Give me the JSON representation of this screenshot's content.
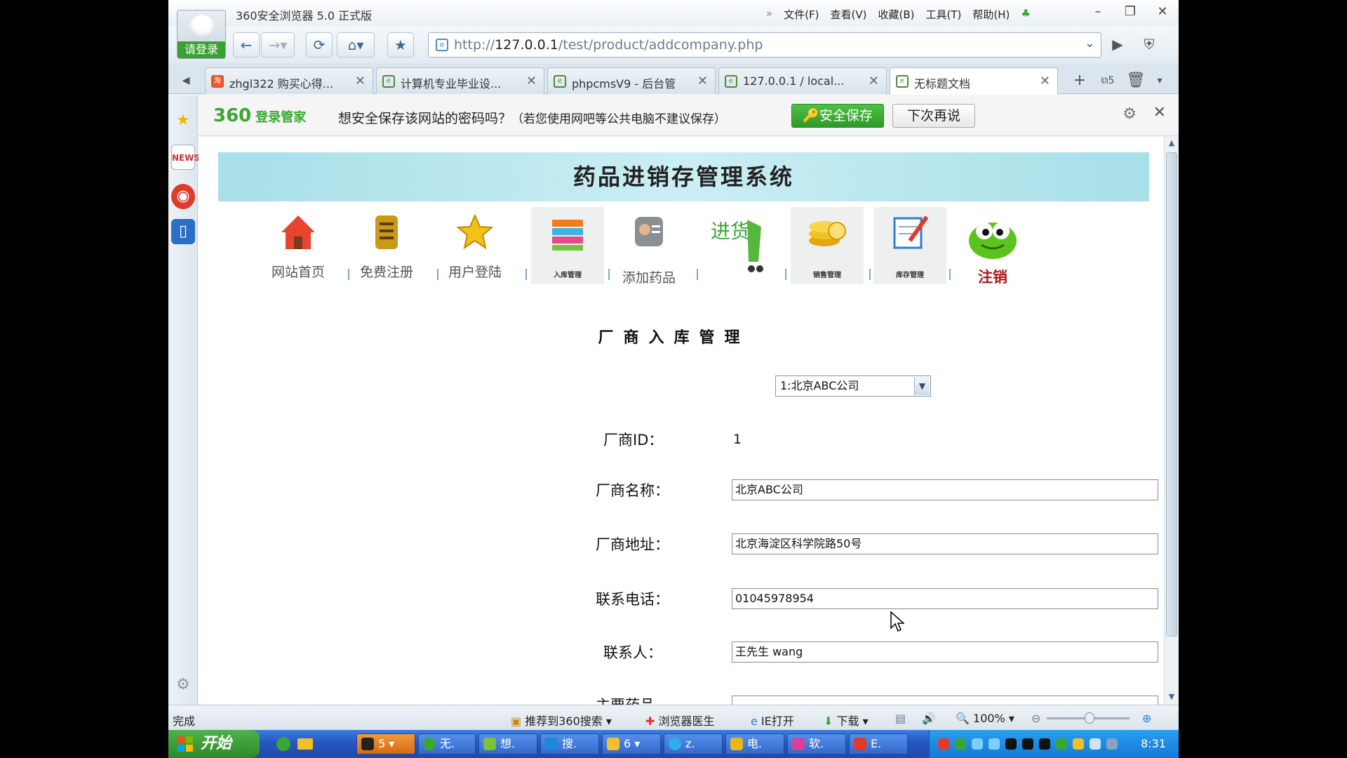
{
  "browser": {
    "login_label": "请登录",
    "app_title": "360安全浏览器 5.0 正式版",
    "menus": [
      "文件(F)",
      "查看(V)",
      "收藏(B)",
      "工具(T)",
      "帮助(H)"
    ],
    "url_prefix": "http://",
    "url_host": "127.0.0.1",
    "url_path": "/test/product/addcompany.php",
    "tabs": [
      {
        "title": "zhgl322 购买心得...",
        "icon": "taobao-icon"
      },
      {
        "title": "计算机专业毕业设...",
        "icon": "page-icon"
      },
      {
        "title": "phpcmsV9 - 后台管...",
        "icon": "page-icon"
      },
      {
        "title": "127.0.0.1 / local...",
        "icon": "page-icon"
      },
      {
        "title": "无标题文档",
        "icon": "page-icon"
      }
    ],
    "tab_count": "5"
  },
  "password_bar": {
    "logo": "360",
    "logo_sub": "登录管家",
    "message": "想安全保存该网站的密码吗？",
    "hint": "（若您使用网吧等公共电脑不建议保存）",
    "save_label": "安全保存",
    "later_label": "下次再说"
  },
  "page": {
    "banner_title": "药品进销存管理系统",
    "nav": [
      {
        "label": "网站首页",
        "icon": "home-icon"
      },
      {
        "label": "免费注册",
        "icon": "register-icon"
      },
      {
        "label": "用户登陆",
        "icon": "star-icon"
      },
      {
        "label": "入库管理",
        "icon": "stock-in-icon"
      },
      {
        "label": "添加药品",
        "icon": "add-drug-icon"
      },
      {
        "label": "进货",
        "icon": "cart-icon"
      },
      {
        "label": "销售管理",
        "icon": "coins-icon"
      },
      {
        "label": "库存管理",
        "icon": "inventory-icon"
      },
      {
        "label": "注销",
        "icon": "logout-frog-icon"
      }
    ],
    "section_title": "厂商入库管理",
    "company_select": "1:北京ABC公司",
    "form": {
      "id_label": "厂商ID：",
      "id_value": "1",
      "name_label": "厂商名称：",
      "name_value": "北京ABC公司",
      "address_label": "厂商地址：",
      "address_value": "北京海淀区科学院路50号",
      "phone_label": "联系电话：",
      "phone_value": "01045978954",
      "contact_label": "联系人：",
      "contact_value": "王先生 wang",
      "main_drug_label": "主要药品"
    }
  },
  "statusbar": {
    "status": "完成",
    "search": "推荐到360搜索",
    "doctor": "浏览器医生",
    "ie_open": "IE打开",
    "download": "下载",
    "zoom": "100%"
  },
  "taskbar": {
    "start": "开始",
    "tasks": [
      "5",
      "无.",
      "想.",
      "搜.",
      "6",
      "z.",
      "电.",
      "软.",
      "E."
    ],
    "clock": "8:31"
  },
  "colors": {
    "banner": "#a8dfe8",
    "save_green": "#3aa733",
    "taskbar_blue": "#2456c2"
  }
}
